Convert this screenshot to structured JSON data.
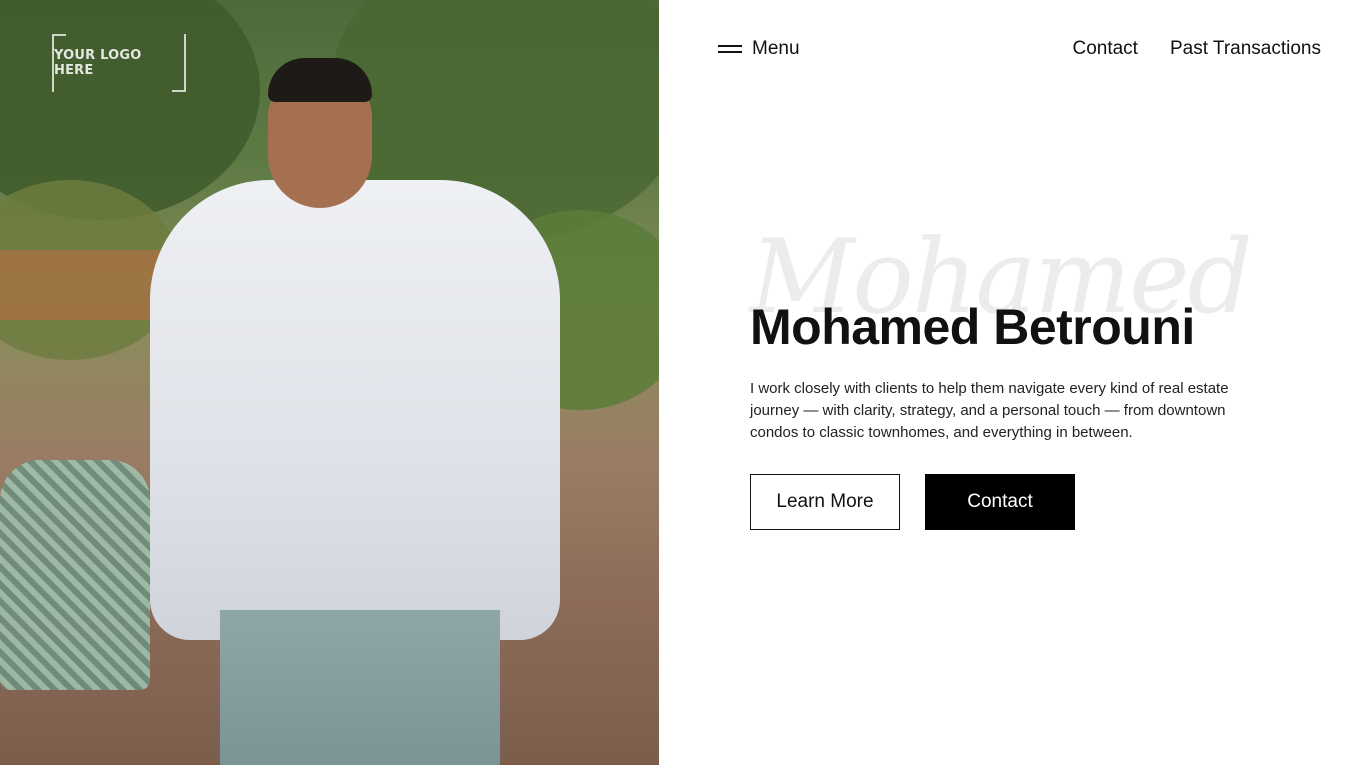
{
  "hero_image": {
    "logo_text": "YOUR LOGO HERE",
    "description": "photo of man in white shirt outdoors"
  },
  "nav": {
    "menu_label": "Menu",
    "links": [
      "Contact",
      "Past Transactions"
    ]
  },
  "hero": {
    "script_text": "Mohamed",
    "title": "Mohamed Betrouni",
    "description": "I work closely with clients to help them navigate every kind of real estate journey — with clarity, strategy, and a personal touch — from downtown condos to classic townhomes, and everything in between.",
    "buttons": {
      "learn_more": "Learn More",
      "contact": "Contact"
    }
  },
  "colors": {
    "background": "#ffffff",
    "text": "#111111",
    "primary_button_bg": "#000000",
    "primary_button_text": "#ffffff"
  }
}
